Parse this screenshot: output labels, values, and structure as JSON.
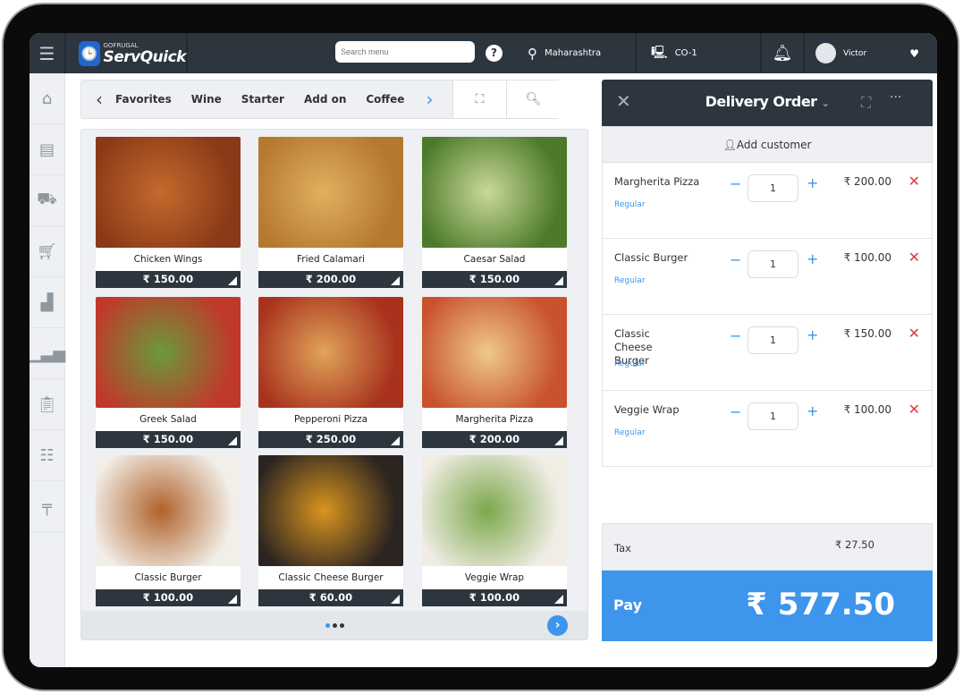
{
  "header": {
    "brand_small": "GOFRUGAL",
    "brand": "ServQuick",
    "search_placeholder": "Search menu",
    "help": "?",
    "location": "Maharashtra",
    "counter": "CO-1",
    "user": "Victor"
  },
  "categories": {
    "items": [
      "Favorites",
      "Wine",
      "Starter",
      "Add on",
      "Coffee"
    ]
  },
  "menu": [
    {
      "name": "Chicken Wings",
      "price": "₹ 150.00",
      "colors": [
        "#8a3a18",
        "#c46a2c"
      ]
    },
    {
      "name": "Fried Calamari",
      "price": "₹ 200.00",
      "colors": [
        "#b5782f",
        "#e0b060"
      ]
    },
    {
      "name": "Caesar Salad",
      "price": "₹ 150.00",
      "colors": [
        "#4d7a2a",
        "#c9d99a"
      ]
    },
    {
      "name": "Greek Salad",
      "price": "₹ 150.00",
      "colors": [
        "#c0392b",
        "#6a9a3a"
      ]
    },
    {
      "name": "Pepperoni Pizza",
      "price": "₹ 250.00",
      "colors": [
        "#a8321e",
        "#e0a458"
      ]
    },
    {
      "name": "Margherita Pizza",
      "price": "₹ 200.00",
      "colors": [
        "#c8522e",
        "#efc98a"
      ]
    },
    {
      "name": "Classic Burger",
      "price": "₹ 100.00",
      "colors": [
        "#f2efe9",
        "#b0622a"
      ]
    },
    {
      "name": "Classic Cheese Burger",
      "price": "₹ 60.00",
      "colors": [
        "#2b2420",
        "#d9951f"
      ]
    },
    {
      "name": "Veggie Wrap",
      "price": "₹ 100.00",
      "colors": [
        "#f1ede5",
        "#7aa84a"
      ]
    }
  ],
  "order": {
    "title": "Delivery Order",
    "add_customer": "Add customer",
    "items": [
      {
        "name": "Margherita Pizza",
        "variant": "Regular",
        "qty": "1",
        "price": "₹ 200.00"
      },
      {
        "name": "Classic Burger",
        "variant": "Regular",
        "qty": "1",
        "price": "₹ 100.00"
      },
      {
        "name": "Classic Cheese Burger",
        "variant": "Regular",
        "qty": "1",
        "price": "₹ 150.00"
      },
      {
        "name": "Veggie Wrap",
        "variant": "Regular",
        "qty": "1",
        "price": "₹ 100.00"
      }
    ],
    "tax_label": "Tax",
    "tax": "₹ 27.50",
    "pay_label": "Pay",
    "total": "₹ 577.50"
  },
  "colors": {
    "topbar": "#2d363f",
    "accent": "#3d95ec",
    "delete": "#e03b3b"
  }
}
